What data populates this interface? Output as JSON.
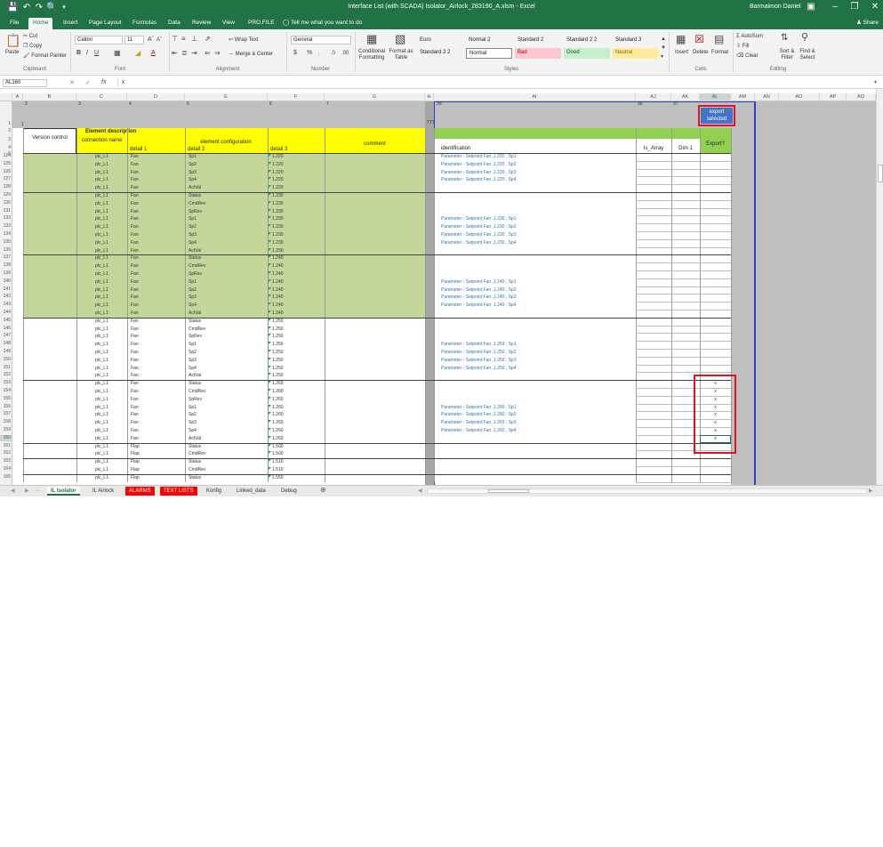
{
  "app": {
    "title": "Interface List (with SCADA) Isolator_Airlock_283190_A.xlsm - Excel",
    "user": "Barmaimon Daniel",
    "share": "Share"
  },
  "ribbon_tabs": [
    "File",
    "Home",
    "Insert",
    "Page Layout",
    "Formulas",
    "Data",
    "Review",
    "View",
    "PRO.FILE"
  ],
  "tell_me": "Tell me what you want to do",
  "ribbon": {
    "paste": "Paste",
    "cut": "Cut",
    "copy": "Copy",
    "format_painter": "Format Painter",
    "font_name": "Calibri",
    "font_size": "11",
    "wrap_text": "Wrap Text",
    "merge_center": "Merge & Center",
    "number_format": "General",
    "conditional": "Conditional Formatting",
    "format_as_table": "Format as Table",
    "styles": [
      {
        "label": "Euro",
        "bg": "#ffffff",
        "fg": "#222222"
      },
      {
        "label": "Normal 2",
        "bg": "#ffffff",
        "fg": "#222222"
      },
      {
        "label": "Standard 2",
        "bg": "#ffffff",
        "fg": "#222222"
      },
      {
        "label": "Standard 2 2",
        "bg": "#ffffff",
        "fg": "#222222"
      },
      {
        "label": "Standard 3",
        "bg": "#ffffff",
        "fg": "#222222"
      },
      {
        "label": "Standard 3 2",
        "bg": "#ffffff",
        "fg": "#222222"
      },
      {
        "label": "Normal",
        "bg": "#ffffff",
        "fg": "#222222"
      },
      {
        "label": "Bad",
        "bg": "#ffc7ce",
        "fg": "#9c0006"
      },
      {
        "label": "Good",
        "bg": "#c6efce",
        "fg": "#006100"
      },
      {
        "label": "Neutral",
        "bg": "#ffeb9c",
        "fg": "#9c5700"
      }
    ],
    "insert": "Insert",
    "delete": "Delete",
    "format": "Format",
    "autosum": "AutoSum",
    "fill": "Fill",
    "clear": "Clear",
    "sort_filter": "Sort & Filter",
    "find_select": "Find & Select",
    "groups": {
      "clipboard": "Clipboard",
      "font": "Font",
      "alignment": "Alignment",
      "number": "Number",
      "styles": "Styles",
      "cells": "Cells",
      "editing": "Editing"
    }
  },
  "formula_bar": {
    "name_box": "AL160",
    "fx": "fx",
    "value": "x"
  },
  "columns": [
    "A",
    "B",
    "C",
    "D",
    "E",
    "F",
    "G",
    "H",
    "AI",
    "AJ",
    "AK",
    "AL",
    "AM",
    "AN",
    "AO",
    "AP",
    "AQ"
  ],
  "top_numbers": {
    "c2": "2",
    "c3": "3",
    "c4": "4",
    "c5": "5",
    "c6": "6",
    "c7": "7",
    "c35": "35",
    "c36": "36",
    "c37": "37",
    "r1": "1",
    "ttt": "TTT"
  },
  "headers": {
    "version_control": "Version control",
    "element_description": "Element description",
    "connection_name": "connection name",
    "element_configuration": "element configuration",
    "detail1": "detail 1",
    "detail2": "detail 2",
    "detail3": "detail 3",
    "comment": "comment",
    "identification": "identification",
    "is_array": "Is_Array",
    "dim1": "Dim 1",
    "export": "Export?",
    "export_selected": "export selected"
  },
  "row_numbers": [
    "1",
    "2",
    "3",
    "4",
    "5",
    "124",
    "125",
    "126",
    "127",
    "128",
    "129",
    "130",
    "131",
    "132",
    "133",
    "134",
    "135",
    "136",
    "137",
    "138",
    "139",
    "140",
    "141",
    "142",
    "143",
    "144",
    "145",
    "146",
    "147",
    "148",
    "149",
    "150",
    "151",
    "152",
    "153",
    "154",
    "155",
    "156",
    "157",
    "158",
    "159",
    "160",
    "161",
    "162",
    "163",
    "164",
    "165"
  ],
  "rows": [
    {
      "c": "plc_L1",
      "d": "Fan",
      "e": "Sp1",
      "f": "1.220",
      "id": "Parameter - Setpoint  Fan ,1.220 , Sp1",
      "x": ""
    },
    {
      "c": "plc_L1",
      "d": "Fan",
      "e": "Sp2",
      "f": "1.220",
      "id": "Parameter - Setpoint  Fan ,1.220 , Sp2",
      "x": ""
    },
    {
      "c": "plc_L1",
      "d": "Fan",
      "e": "Sp3",
      "f": "1.220",
      "id": "Parameter - Setpoint  Fan ,1.220 , Sp3",
      "x": ""
    },
    {
      "c": "plc_L1",
      "d": "Fan",
      "e": "Sp4",
      "f": "1.220",
      "id": "Parameter - Setpoint  Fan ,1.220 , Sp4",
      "x": ""
    },
    {
      "c": "plc_L1",
      "d": "Fan",
      "e": "ActVal",
      "f": "1.220",
      "id": "",
      "x": ""
    },
    {
      "c": "plc_L1",
      "d": "Fan",
      "e": "Status",
      "f": "1.230",
      "id": "",
      "x": ""
    },
    {
      "c": "plc_L1",
      "d": "Fan",
      "e": "CmdRev",
      "f": "1.230",
      "id": "",
      "x": ""
    },
    {
      "c": "plc_L1",
      "d": "Fan",
      "e": "SpRev",
      "f": "1.230",
      "id": "",
      "x": ""
    },
    {
      "c": "plc_L1",
      "d": "Fan",
      "e": "Sp1",
      "f": "1.230",
      "id": "Parameter - Setpoint  Fan ,1.230 , Sp1",
      "x": ""
    },
    {
      "c": "plc_L1",
      "d": "Fan",
      "e": "Sp2",
      "f": "1.230",
      "id": "Parameter - Setpoint  Fan ,1.230 , Sp2",
      "x": ""
    },
    {
      "c": "plc_L1",
      "d": "Fan",
      "e": "Sp3",
      "f": "1.230",
      "id": "Parameter - Setpoint  Fan ,1.230 , Sp3",
      "x": ""
    },
    {
      "c": "plc_L1",
      "d": "Fan",
      "e": "Sp4",
      "f": "1.230",
      "id": "Parameter - Setpoint  Fan ,1.230 , Sp4",
      "x": ""
    },
    {
      "c": "plc_L1",
      "d": "Fan",
      "e": "ActVal",
      "f": "1.230",
      "id": "",
      "x": ""
    },
    {
      "c": "plc_L1",
      "d": "Fan",
      "e": "Status",
      "f": "1.240",
      "id": "",
      "x": ""
    },
    {
      "c": "plc_L1",
      "d": "Fan",
      "e": "CmdRev",
      "f": "1.240",
      "id": "",
      "x": ""
    },
    {
      "c": "plc_L1",
      "d": "Fan",
      "e": "SpRev",
      "f": "1.240",
      "id": "",
      "x": ""
    },
    {
      "c": "plc_L1",
      "d": "Fan",
      "e": "Sp1",
      "f": "1.240",
      "id": "Parameter - Setpoint  Fan ,1.240 , Sp1",
      "x": ""
    },
    {
      "c": "plc_L1",
      "d": "Fan",
      "e": "Sp2",
      "f": "1.240",
      "id": "Parameter - Setpoint  Fan ,1.240 , Sp2",
      "x": ""
    },
    {
      "c": "plc_L1",
      "d": "Fan",
      "e": "Sp3",
      "f": "1.240",
      "id": "Parameter - Setpoint  Fan ,1.240 , Sp3",
      "x": ""
    },
    {
      "c": "plc_L1",
      "d": "Fan",
      "e": "Sp4",
      "f": "1.240",
      "id": "Parameter - Setpoint  Fan ,1.240 , Sp4",
      "x": ""
    },
    {
      "c": "plc_L1",
      "d": "Fan",
      "e": "ActVal",
      "f": "1.240",
      "id": "",
      "x": ""
    },
    {
      "c": "plc_L1",
      "d": "Fan",
      "e": "Status",
      "f": "1.250",
      "id": "",
      "x": ""
    },
    {
      "c": "plc_L1",
      "d": "Fan",
      "e": "CmdRev",
      "f": "1.250",
      "id": "",
      "x": ""
    },
    {
      "c": "plc_L1",
      "d": "Fan",
      "e": "SpRev",
      "f": "1.250",
      "id": "",
      "x": ""
    },
    {
      "c": "plc_L1",
      "d": "Fan",
      "e": "Sp1",
      "f": "1.250",
      "id": "Parameter - Setpoint  Fan ,1.250 , Sp1",
      "x": ""
    },
    {
      "c": "plc_L1",
      "d": "Fan",
      "e": "Sp2",
      "f": "1.250",
      "id": "Parameter - Setpoint  Fan ,1.250 , Sp2",
      "x": ""
    },
    {
      "c": "plc_L1",
      "d": "Fan",
      "e": "Sp3",
      "f": "1.250",
      "id": "Parameter - Setpoint  Fan ,1.250 , Sp3",
      "x": ""
    },
    {
      "c": "plc_L1",
      "d": "Fan",
      "e": "Sp4",
      "f": "1.250",
      "id": "Parameter - Setpoint  Fan ,1.250 , Sp4",
      "x": ""
    },
    {
      "c": "plc_L1",
      "d": "Fan",
      "e": "ActVal",
      "f": "1.250",
      "id": "",
      "x": ""
    },
    {
      "c": "plc_L1",
      "d": "Fan",
      "e": "Status",
      "f": "1.260",
      "id": "",
      "x": "x"
    },
    {
      "c": "plc_L1",
      "d": "Fan",
      "e": "CmdRev",
      "f": "1.260",
      "id": "",
      "x": "x"
    },
    {
      "c": "plc_L1",
      "d": "Fan",
      "e": "SpRev",
      "f": "1.260",
      "id": "",
      "x": "x"
    },
    {
      "c": "plc_L1",
      "d": "Fan",
      "e": "Sp1",
      "f": "1.260",
      "id": "Parameter - Setpoint  Fan ,1.260 , Sp1",
      "x": "x"
    },
    {
      "c": "plc_L1",
      "d": "Fan",
      "e": "Sp2",
      "f": "1.260",
      "id": "Parameter - Setpoint  Fan ,1.260 , Sp2",
      "x": "x"
    },
    {
      "c": "plc_L1",
      "d": "Fan",
      "e": "Sp3",
      "f": "1.260",
      "id": "Parameter - Setpoint  Fan ,1.260 , Sp3",
      "x": "x"
    },
    {
      "c": "plc_L1",
      "d": "Fan",
      "e": "Sp4",
      "f": "1.260",
      "id": "Parameter - Setpoint  Fan ,1.260 , Sp4",
      "x": "x"
    },
    {
      "c": "plc_L1",
      "d": "Fan",
      "e": "ActVal",
      "f": "1.260",
      "id": "",
      "x": "x"
    },
    {
      "c": "plc_L1",
      "d": "Flap",
      "e": "Status",
      "f": "1.500",
      "id": "",
      "x": ""
    },
    {
      "c": "plc_L1",
      "d": "Flap",
      "e": "CmdRev",
      "f": "1.500",
      "id": "",
      "x": ""
    },
    {
      "c": "plc_L1",
      "d": "Flap",
      "e": "Status",
      "f": "1.510",
      "id": "",
      "x": ""
    },
    {
      "c": "plc_L1",
      "d": "Flap",
      "e": "CmdRev",
      "f": "1.510",
      "id": "",
      "x": ""
    },
    {
      "c": "plc_L1",
      "d": "Flap",
      "e": "Status",
      "f": "1.550",
      "id": "",
      "x": ""
    }
  ],
  "sheet_tabs": [
    {
      "label": "IL Isolator",
      "kind": "active"
    },
    {
      "label": "IL Airlock",
      "kind": "normal"
    },
    {
      "label": "ALARMS",
      "kind": "red"
    },
    {
      "label": "TEXT LISTS",
      "kind": "red"
    },
    {
      "label": "Konfig",
      "kind": "normal"
    },
    {
      "label": "Linked_data",
      "kind": "normal"
    },
    {
      "label": "Debug",
      "kind": "normal"
    }
  ],
  "colors": {
    "ribbon_green": "#217346",
    "band_green": "#c4d79b",
    "header_yellow": "#ffff00",
    "header_green": "#92d050",
    "id_blue": "#2e75b6",
    "highlight_red": "#e81123",
    "button_blue": "#4472c4"
  }
}
